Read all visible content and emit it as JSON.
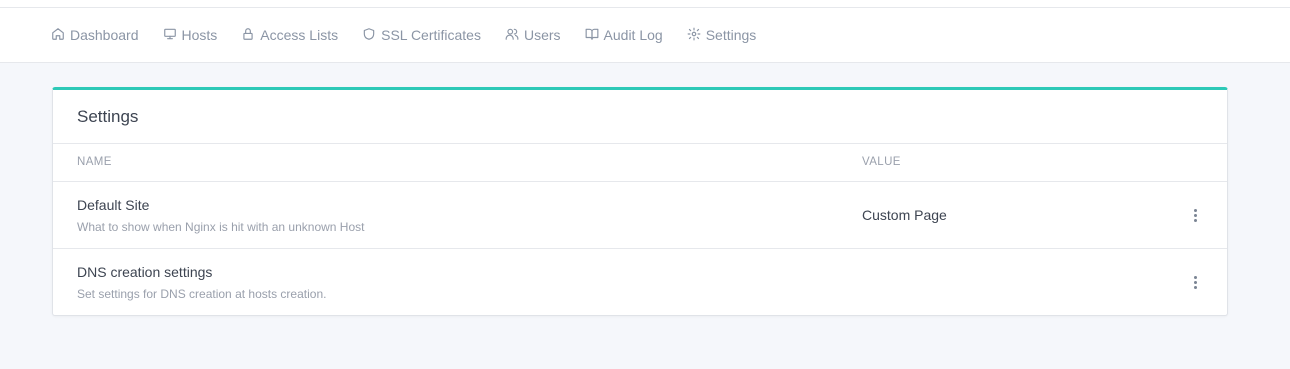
{
  "nav": {
    "items": [
      {
        "label": "Dashboard",
        "icon": "home-icon"
      },
      {
        "label": "Hosts",
        "icon": "monitor-icon"
      },
      {
        "label": "Access Lists",
        "icon": "lock-icon"
      },
      {
        "label": "SSL Certificates",
        "icon": "shield-icon"
      },
      {
        "label": "Users",
        "icon": "users-icon"
      },
      {
        "label": "Audit Log",
        "icon": "book-icon"
      },
      {
        "label": "Settings",
        "icon": "gear-icon"
      }
    ]
  },
  "card": {
    "title": "Settings",
    "accent_color": "#2dc9b7",
    "columns": [
      "NAME",
      "VALUE"
    ],
    "rows": [
      {
        "name": "Default Site",
        "description": "What to show when Nginx is hit with an unknown Host",
        "value": "Custom Page"
      },
      {
        "name": "DNS creation settings",
        "description": "Set settings for DNS creation at hosts creation.",
        "value": ""
      }
    ]
  }
}
